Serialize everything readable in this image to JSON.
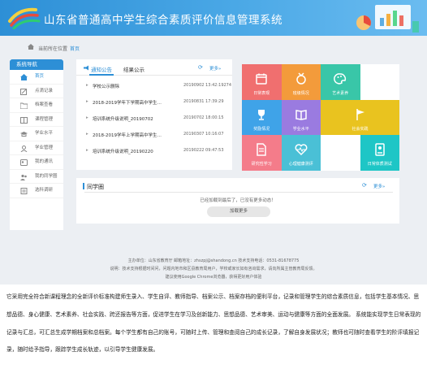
{
  "header": {
    "title": "山东省普通高中学生综合素质评价信息管理系统"
  },
  "breadcrumb": {
    "location": "当前所在位置",
    "current": "首页"
  },
  "sidebar": {
    "title": "系统导航",
    "items": [
      {
        "label": "首页",
        "icon": "home-icon"
      },
      {
        "label": "点滴记录",
        "icon": "edit-icon"
      },
      {
        "label": "档案查看",
        "icon": "folder-icon"
      },
      {
        "label": "课程管理",
        "icon": "book-icon"
      },
      {
        "label": "学业水平",
        "icon": "graduation-icon"
      },
      {
        "label": "学业管理",
        "icon": "user-cap-icon"
      },
      {
        "label": "我的通讯",
        "icon": "contact-icon"
      },
      {
        "label": "我的同学圈",
        "icon": "people-icon"
      },
      {
        "label": "选科调研",
        "icon": "survey-icon"
      }
    ]
  },
  "notice": {
    "tab_notice": "通知公告",
    "tab_result": "结果公示",
    "refresh": "⟳",
    "more": "更多»",
    "items": [
      {
        "title": "学校公示删除",
        "date": "20190902 13:42:19274"
      },
      {
        "title": "2018-2019学年下学期高中学生…",
        "date": "20190831 17:39:29"
      },
      {
        "title": "培训系统升级说明_20190702",
        "date": "20190702 18:00:15"
      },
      {
        "title": "2018-2019学年上学期高中学生…",
        "date": "20190307 10:16:07"
      },
      {
        "title": "培训系统升级说明_20190220",
        "date": "20190222 09:47:53"
      }
    ]
  },
  "tiles": [
    {
      "label": "日常表现",
      "color": "#f06f6f",
      "icon": "calendar-icon"
    },
    {
      "label": "班级情况",
      "color": "#f39b3b",
      "icon": "medal-icon"
    },
    {
      "label": "艺术素养",
      "color": "#39c6a8",
      "icon": "palette-icon"
    },
    {
      "label": "奖励情况",
      "color": "#3fa3e8",
      "icon": "trophy-icon"
    },
    {
      "label": "学业水平",
      "color": "#9a7be0",
      "icon": "book-icon"
    },
    {
      "label": "社会实践",
      "color": "#e9c31f",
      "icon": "flag-icon"
    },
    {
      "label": "研究性学习",
      "color": "#f47c8a",
      "icon": "document-icon"
    },
    {
      "label": "心理健康测评",
      "color": "#4ac0d6",
      "icon": "heart-icon"
    },
    {
      "label": "日常体质测试",
      "color": "#1ec6c6",
      "icon": "id-card-icon"
    }
  ],
  "classmates": {
    "title": "同学圈",
    "refresh": "⟳",
    "more": "更多»",
    "message": "已经加载到最后了，已没有更多动态！",
    "load_more": "加载更多"
  },
  "footer": {
    "line1": "主办单位：山东省教育厅        邮箱地址：zhszpj@shandong.cn        技术支持电话：0531-81678775",
    "line2": "说明：技术支持根据时间问，问题内地市和区县教育局用户，学校或家长如有咨询需求，请向所属主管教育局反馈。",
    "line3": "建议使用Google Chrome浏览器，获得更好用户体验"
  },
  "description": "它采用完全符合新课程理念的全新评价标准构建师生录入、学生自评、教师指导、档案公示、档案存档的便利平台，记录和管理学生的综合素质信息，包括学生基本情况、思想品德、身心健康、艺术素养、社会实践、跨还报告等方面，促进学生在学习及创新能力、思想品德、艺术审美、运动与健康等方面的全面发展。 系统能实现学生日常表现的记录与汇总，可汇总生成学期档案和总档案。每个学生都有自己的账号，可随时上传、管理和查阅自己的成长记录，了解自身发展状况；教师也可随时查看学生的阶评填报记录，随时给予指导，跟踪学生成长轨迹，以引导学生健康发展。"
}
